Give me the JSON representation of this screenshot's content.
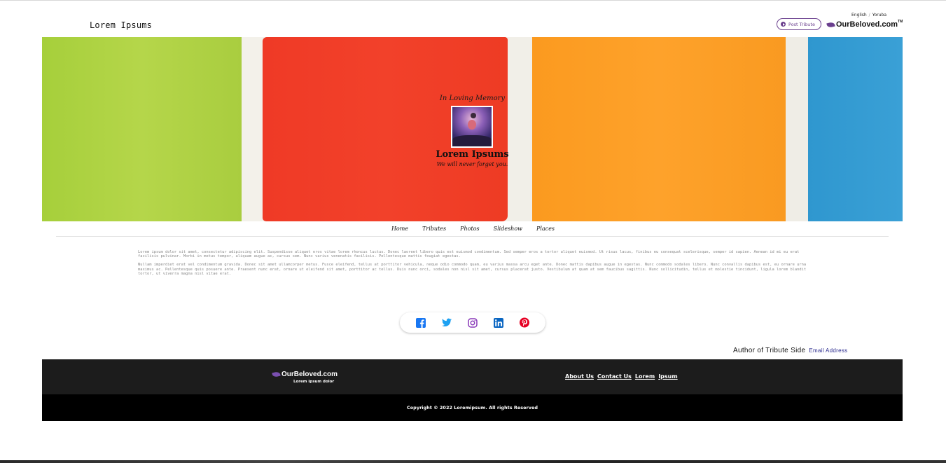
{
  "header": {
    "site_title": "Lorem Ipsums",
    "lang_english": "English",
    "lang_sep": "/",
    "lang_yoruba": "Yoruba",
    "post_tribute": "Post Tribute",
    "brand": "OurBeloved.com",
    "brand_tm": "TM"
  },
  "hero": {
    "in_loving_memory": "In Loving Memory",
    "name": "Lorem Ipsums",
    "subtitle": "We will never forget you."
  },
  "nav": {
    "items": [
      "Home",
      "Tributes",
      "Photos",
      "Slideshow",
      "Places"
    ]
  },
  "content": {
    "paragraph1": "Lorem ipsum dolor sit amet, consectetur adipiscing elit. Suspendisse aliquet eros vitae lorem rhoncus luctus. Donec laoreet libero quis est euismod condimentum. Sed semper eros a tortor aliquet euismod. Ut risus lacus, finibus eu consequat scelerisque, semper id sapien. Aenean id mi eu erat facilisis pulvinar. Morbi in metus tempor, aliquam augue ac, cursus sem. Nunc varius venenatis facilisis. Pellentesque mattis feugiat egestas.",
    "paragraph2": "Nullam imperdiet erat vel condimentum gravida. Donec sit amet ullamcorper metus. Fusce eleifend, tellus at porttitor vehicula, neque odio commodo quam, eu varius massa arcu eget ante. Donec mattis dapibus augue in egestas. Nunc commodo sodales libero. Nunc convallis dapibus est, eu ornare urna maximus ac. Pellentesque quis posuere ante. Praesent nunc erat, ornare ut eleifend sit amet, porttitor ac tellus. Duis nunc orci, sodales non nisl sit amet, cursus placerat justo. Vestibulum at quam at sem faucibus sagittis. Nunc sollicitudin, tellus et molestie tincidunt, ligula lorem blandit tortor, ut viverra magna nisl vitae erat."
  },
  "social": {
    "icons": [
      "facebook-icon",
      "twitter-icon",
      "instagram-icon",
      "linkedin-icon",
      "pinterest-icon"
    ],
    "colors": {
      "facebook": "#1877f2",
      "twitter": "#1da1f2",
      "instagram": "#8a3ab9",
      "linkedin": "#0a66c2",
      "pinterest": "#e60023"
    }
  },
  "author": {
    "label": "Author of Tribute Side",
    "email": "Email Address"
  },
  "footer": {
    "brand": "OurBeloved.com",
    "tagline": "Lorem ipsum dolor",
    "links": [
      "About Us",
      "Contact Us",
      "Lorem",
      "Ipsum"
    ],
    "copyright": "Copyright © 2022 Loremipsum. All rights Reserved"
  },
  "colors": {
    "brand_purple": "#6a3f8e",
    "footer_dark": "#1c1c1c",
    "footer_black": "#000000"
  }
}
